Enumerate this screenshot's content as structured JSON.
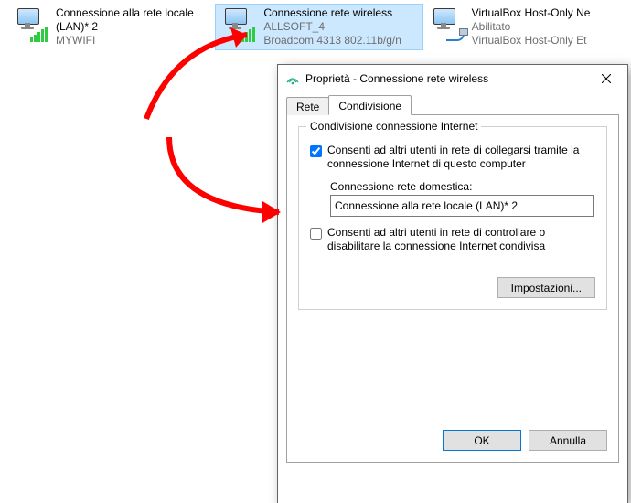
{
  "connections": [
    {
      "name": "Connessione alla rete locale (LAN)* 2",
      "status": "MYWIFI",
      "detail": "",
      "type": "wifi"
    },
    {
      "name": "Connessione rete wireless",
      "status": "ALLSOFT_4",
      "detail": "Broadcom 4313 802.11b/g/n",
      "type": "wifi"
    },
    {
      "name": "VirtualBox Host-Only Ne",
      "status": "Abilitato",
      "detail": "VirtualBox Host-Only Et",
      "type": "eth"
    }
  ],
  "dialog": {
    "title": "Proprietà - Connessione rete wireless",
    "tabs": {
      "network": "Rete",
      "sharing": "Condivisione"
    },
    "group_title": "Condivisione connessione Internet",
    "allow_share_label": "Consenti ad altri utenti in rete di collegarsi tramite la connessione Internet di questo computer",
    "home_label": "Connessione rete domestica:",
    "home_value": "Connessione alla rete locale (LAN)* 2",
    "allow_control_label": "Consenti ad altri utenti in rete di controllare o disabilitare la connessione Internet condivisa",
    "settings_btn": "Impostazioni...",
    "ok": "OK",
    "cancel": "Annulla"
  }
}
